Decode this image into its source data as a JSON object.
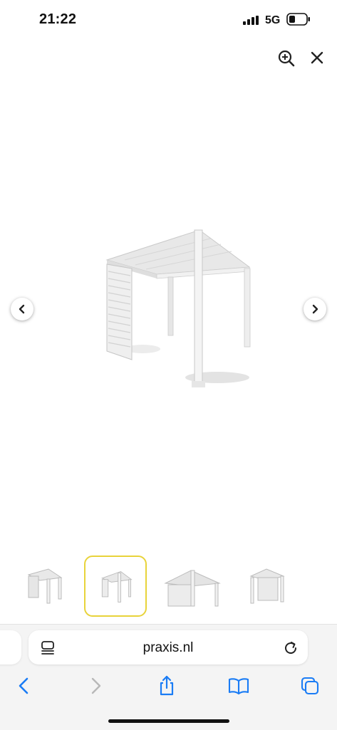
{
  "status_bar": {
    "time": "21:22",
    "network": "5G"
  },
  "viewer": {
    "zoom_icon": "zoom-in-icon",
    "close_icon": "close-icon",
    "prev_icon": "chevron-left-icon",
    "next_icon": "chevron-right-icon",
    "thumbnail_count": 4,
    "selected_thumbnail": 2,
    "selected_border_color": "#e8d33a"
  },
  "browser": {
    "url": "praxis.nl",
    "toolbar": [
      "back",
      "forward",
      "share",
      "bookmarks",
      "tabs"
    ],
    "accent": "#1a7cf5"
  }
}
